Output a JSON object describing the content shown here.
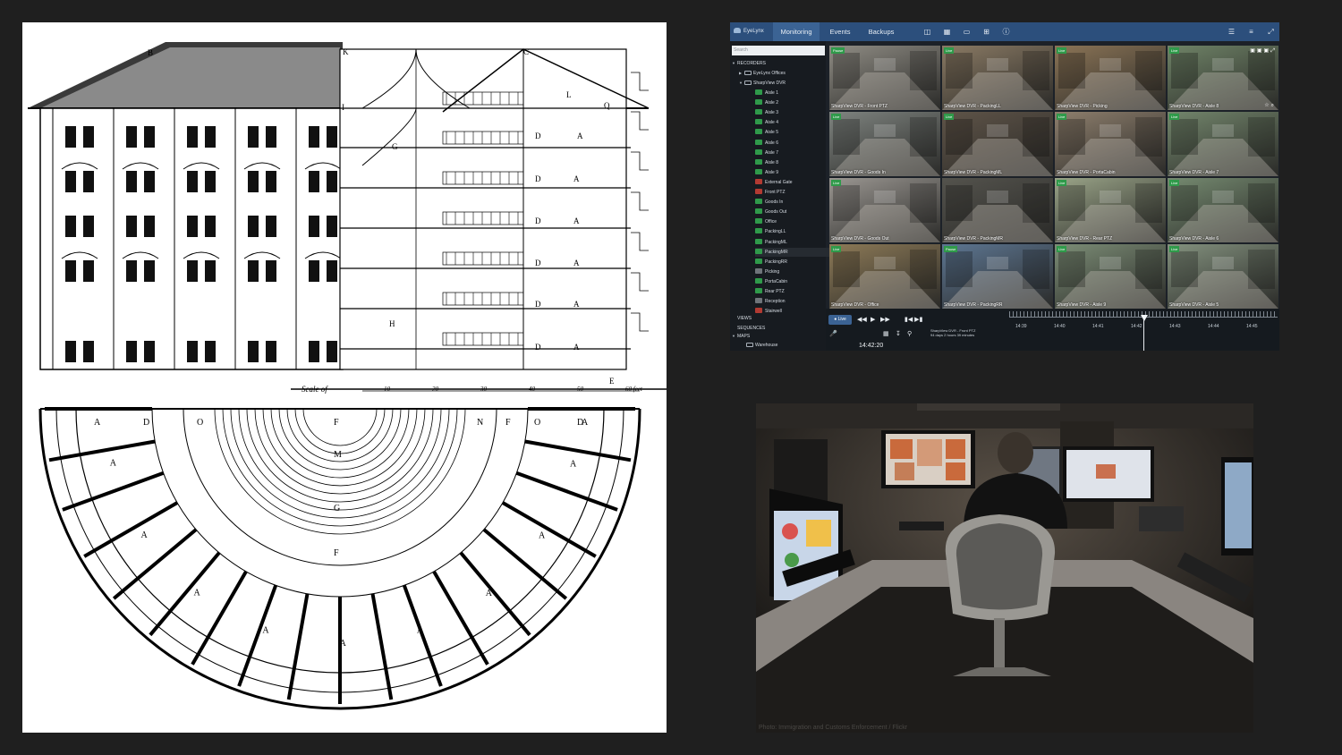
{
  "vms": {
    "brand": "EyeLynx",
    "tabs": [
      "Monitoring",
      "Events",
      "Backups"
    ],
    "active_tab": "Monitoring",
    "search_placeholder": "Search",
    "tree": {
      "recorders_label": "RECORDERS",
      "group_offices": "EyeLynx Offices",
      "group_dvr": "SharpView DVR",
      "cameras": [
        {
          "name": "Aisle 1",
          "state": "green"
        },
        {
          "name": "Aisle 2",
          "state": "green"
        },
        {
          "name": "Aisle 3",
          "state": "green"
        },
        {
          "name": "Aisle 4",
          "state": "green"
        },
        {
          "name": "Aisle 5",
          "state": "green"
        },
        {
          "name": "Aisle 6",
          "state": "green"
        },
        {
          "name": "Aisle 7",
          "state": "green"
        },
        {
          "name": "Aisle 8",
          "state": "green"
        },
        {
          "name": "Aisle 9",
          "state": "green"
        },
        {
          "name": "External Gate",
          "state": "red"
        },
        {
          "name": "Front PTZ",
          "state": "red"
        },
        {
          "name": "Goods In",
          "state": "green"
        },
        {
          "name": "Goods Out",
          "state": "green"
        },
        {
          "name": "Office",
          "state": "green"
        },
        {
          "name": "PackingLL",
          "state": "green"
        },
        {
          "name": "PackingML",
          "state": "green"
        },
        {
          "name": "PackingMR",
          "state": "green"
        },
        {
          "name": "PackingRR",
          "state": "green"
        },
        {
          "name": "Picking",
          "state": "grey"
        },
        {
          "name": "PortaCabin",
          "state": "green"
        },
        {
          "name": "Rear PTZ",
          "state": "green"
        },
        {
          "name": "Reception",
          "state": "grey"
        },
        {
          "name": "Stairwell",
          "state": "red"
        }
      ],
      "views_label": "VIEWS",
      "sequences_label": "SEQUENCES",
      "maps_label": "MAPS",
      "map_item": "Warehouse"
    },
    "tiles": [
      {
        "label": "SharpView DVR - Front PTZ",
        "badge": "Pause",
        "tone": "#8f8c84"
      },
      {
        "label": "SharpView DVR - PackingLL",
        "badge": "Live",
        "tone": "#8a7a64"
      },
      {
        "label": "SharpView DVR - Picking",
        "badge": "Live",
        "tone": "#8b7456"
      },
      {
        "label": "SharpView DVR - Aisle 8",
        "badge": "Live",
        "tone": "#6f8367"
      },
      {
        "label": "SharpView DVR - Goods In",
        "badge": "Live",
        "tone": "#7f8480"
      },
      {
        "label": "SharpView DVR - PackingML",
        "badge": "Live",
        "tone": "#5f5448"
      },
      {
        "label": "SharpView DVR - PortaCabin",
        "badge": "Live",
        "tone": "#8e7f6d"
      },
      {
        "label": "SharpView DVR - Aisle 7",
        "badge": "Live",
        "tone": "#73866c"
      },
      {
        "label": "SharpView DVR - Goods Out",
        "badge": "Live",
        "tone": "#9b9792"
      },
      {
        "label": "SharpView DVR - PackingMR",
        "badge": "",
        "tone": "#54534d"
      },
      {
        "label": "SharpView DVR - Rear PTZ",
        "badge": "Live",
        "tone": "#9aa488"
      },
      {
        "label": "SharpView DVR - Aisle 6",
        "badge": "Live",
        "tone": "#758a70"
      },
      {
        "label": "SharpView DVR - Office",
        "badge": "Live",
        "tone": "#8d7a57"
      },
      {
        "label": "SharpView DVR - PackingRR",
        "badge": "Pause",
        "tone": "#5d7692"
      },
      {
        "label": "SharpView DVR - Aisle 9",
        "badge": "Live",
        "tone": "#7c8d76"
      },
      {
        "label": "SharpView DVR - Aisle 5",
        "badge": "Live",
        "tone": "#83917e"
      }
    ],
    "controls": {
      "live_label": "Live",
      "camera_info_line1": "SharpView DVR - Front PTZ",
      "camera_info_line2": "94 days 2 hours 39 minutes",
      "time": "14:42:20",
      "ticks": [
        "14:39",
        "14:40",
        "14:41",
        "14:42",
        "14:43",
        "14:44",
        "14:45"
      ]
    }
  },
  "drawing": {
    "letters_elevation": [
      "B",
      "K",
      "C",
      "I",
      "L",
      "Q",
      "G",
      "D",
      "A",
      "H",
      "E"
    ],
    "scale_text": "Scale of",
    "scale_numbers": [
      "10",
      "20",
      "30",
      "40",
      "50",
      "60 feet"
    ],
    "plan_top_letters": [
      "A",
      "D",
      "O",
      "F",
      "N",
      "F",
      "O",
      "D",
      "A"
    ],
    "plan_letters": [
      "M",
      "G",
      "F",
      "A"
    ]
  },
  "photo": {
    "credit": "Photo: Immigration and Customs Enforcement / Flickr"
  },
  "colors": {
    "background": "#1f1f1f",
    "vms_topbar": "#2c4f7c",
    "vms_active_tab": "#3b6394",
    "live_green": "#2f9a4a",
    "alarm_red": "#b23a32"
  }
}
